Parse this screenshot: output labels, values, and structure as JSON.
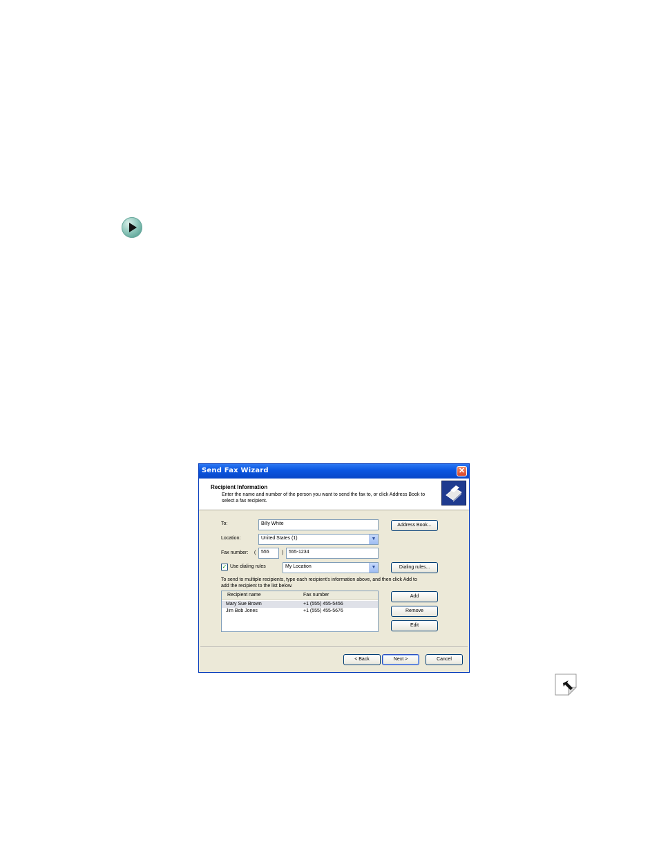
{
  "bullet": {
    "icon": "play-arrow-icon"
  },
  "dialog": {
    "title": "Send Fax Wizard",
    "close_icon": "close-icon",
    "header": {
      "title": "Recipient Information",
      "description": "Enter the name and number of the person you want to send the fax to, or click Address Book to select a fax recipient.",
      "icon": "fax-icon"
    },
    "to": {
      "label": "To:",
      "value": "Billy White"
    },
    "location": {
      "label": "Location:",
      "value": "United States (1)"
    },
    "fax_number": {
      "label": "Fax number:",
      "open_paren": "(",
      "area_code": "555",
      "close_paren": ")",
      "number": "555-1234"
    },
    "dialing_rules": {
      "label": "Use dialing rules",
      "checked": true,
      "value": "My Location"
    },
    "instructions": "To send to multiple recipients, type each recipient's information above, and then click Add to add the recipient to the list below.",
    "buttons": {
      "address_book": "Address Book...",
      "dialing_rules": "Dialing rules...",
      "add": "Add",
      "remove": "Remove",
      "edit": "Edit",
      "back": "< Back",
      "next": "Next >",
      "cancel": "Cancel"
    },
    "list": {
      "columns": [
        "Recipient name",
        "Fax number"
      ],
      "rows": [
        {
          "name": "Mary Sue Brown",
          "fax": "+1 (555) 455-5456"
        },
        {
          "name": "Jim Bob Jones",
          "fax": "+1 (555) 455-5676"
        }
      ]
    }
  },
  "page_corner": {
    "icon": "page-corner-arrow-icon"
  }
}
